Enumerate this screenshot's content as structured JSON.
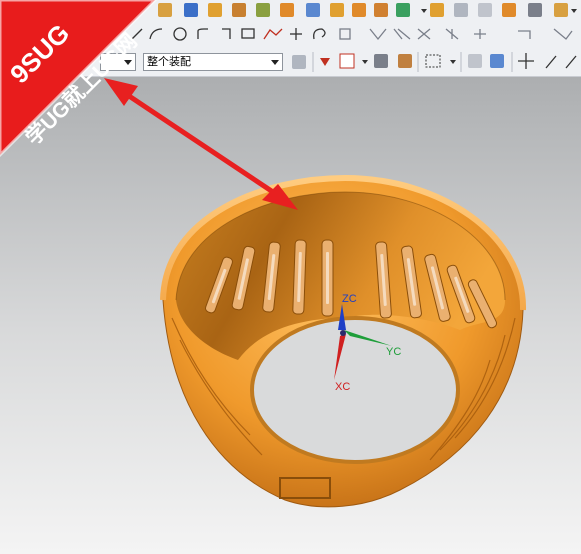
{
  "watermark": {
    "brand": "9SUG",
    "slogan": "学UG就上UG网",
    "background_color": "#e81c1c"
  },
  "toolbar": {
    "assembly_filter": {
      "selected": "整个装配"
    }
  },
  "wcs": {
    "zc_label": "ZC",
    "yc_label": "YC",
    "xc_label": "XC",
    "colors": {
      "z": "#1f3fc6",
      "y": "#1e9e3a",
      "x": "#d02020"
    }
  },
  "colors": {
    "part": "#f0a030",
    "annotation_arrow": "#e82020",
    "toolbar_bg": "#eef0f3"
  }
}
